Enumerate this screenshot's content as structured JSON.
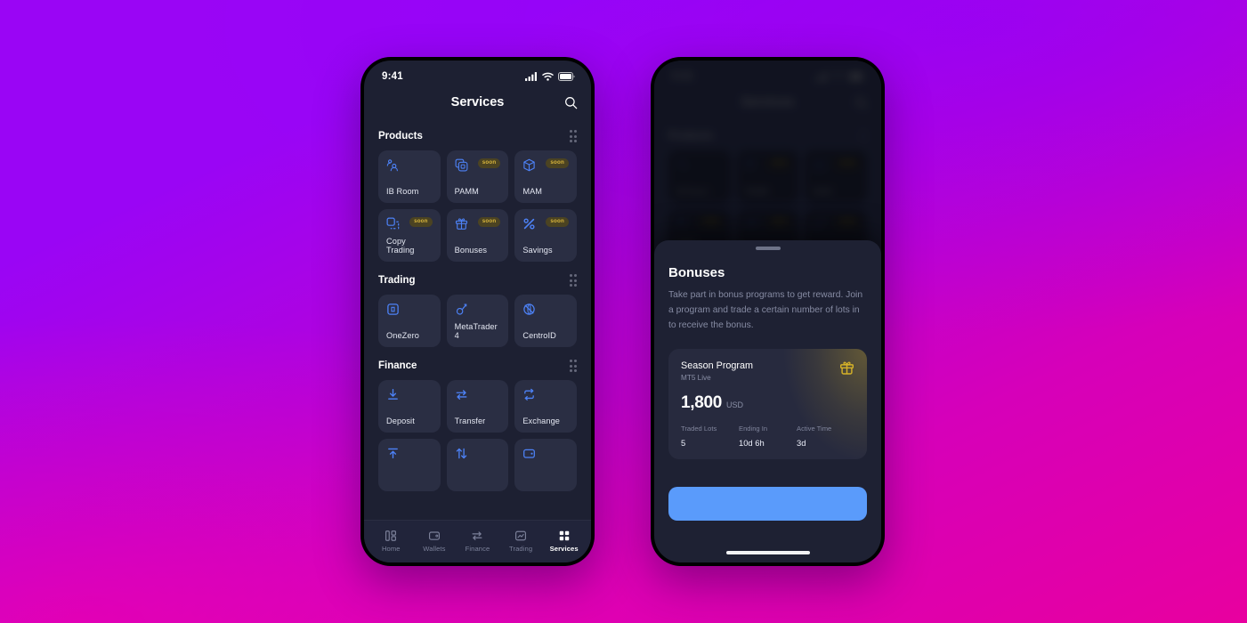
{
  "theme": {
    "bg_purple": "#9a05f5",
    "bg_magenta": "#e8009f",
    "screen_bg": "#1d2032",
    "tile_bg": "#2a2e43",
    "accent_blue": "#4d82f7",
    "cta_blue": "#5a9bfb",
    "badge_gold": "#d9b63c",
    "gift_gold": "#d6b228"
  },
  "phone_one": {
    "status_bar": {
      "time": "9:41",
      "signal_icon": "cellular-bars-icon",
      "wifi_icon": "wifi-icon",
      "battery_icon": "battery-icon"
    },
    "nav": {
      "title": "Services",
      "search_icon": "search-icon"
    },
    "sections": [
      {
        "title": "Products",
        "handle_icon": "drag-handle-icon",
        "tiles": [
          {
            "label": "IB Room",
            "icon": "users-icon",
            "badge": ""
          },
          {
            "label": "PAMM",
            "icon": "copy-box-icon",
            "badge": "soon"
          },
          {
            "label": "MAM",
            "icon": "cube-icon",
            "badge": "soon"
          },
          {
            "label": "Copy Trading",
            "icon": "copy-dashed-icon",
            "badge": "soon"
          },
          {
            "label": "Bonuses",
            "icon": "gift-icon",
            "badge": "soon"
          },
          {
            "label": "Savings",
            "icon": "percent-icon",
            "badge": "soon"
          }
        ]
      },
      {
        "title": "Trading",
        "handle_icon": "drag-handle-icon",
        "tiles": [
          {
            "label": "OneZero",
            "icon": "square-bracket-icon",
            "badge": ""
          },
          {
            "label": "MetaTrader 4",
            "icon": "mt4-icon",
            "badge": ""
          },
          {
            "label": "CentroID",
            "icon": "globe-slash-icon",
            "badge": ""
          }
        ]
      },
      {
        "title": "Finance",
        "handle_icon": "drag-handle-icon",
        "tiles": [
          {
            "label": "Deposit",
            "icon": "download-arrow-icon",
            "badge": ""
          },
          {
            "label": "Transfer",
            "icon": "exchange-arrows-icon",
            "badge": ""
          },
          {
            "label": "Exchange",
            "icon": "refresh-loop-icon",
            "badge": ""
          }
        ],
        "tiles_clipped": [
          {
            "label": "",
            "icon": "upload-arrow-icon",
            "badge": ""
          },
          {
            "label": "",
            "icon": "up-down-arrows-icon",
            "badge": ""
          },
          {
            "label": "",
            "icon": "wallet-icon",
            "badge": ""
          }
        ]
      }
    ],
    "tabbar": [
      {
        "label": "Home",
        "icon": "dashboard-icon",
        "active": false
      },
      {
        "label": "Wallets",
        "icon": "wallet-icon",
        "active": false
      },
      {
        "label": "Finance",
        "icon": "transfer-icon",
        "active": false
      },
      {
        "label": "Trading",
        "icon": "chart-icon",
        "active": false
      },
      {
        "label": "Services",
        "icon": "grid-icon",
        "active": true
      }
    ]
  },
  "phone_two": {
    "sheet": {
      "grabber_icon": "sheet-grabber-icon",
      "title": "Bonuses",
      "description": "Take part in bonus programs to get reward. Join\na program and trade a certain number of lots in\nto receive the bonus.",
      "card": {
        "name": "Season Program",
        "subtitle": "MT5 Live",
        "amount": "1,800",
        "currency": "USD",
        "gift_icon": "gift-icon",
        "stats": [
          {
            "key": "Traded Lots",
            "value": "5"
          },
          {
            "key": "Ending In",
            "value": "10d 6h"
          },
          {
            "key": "Active Time",
            "value": "3d"
          }
        ]
      },
      "cta_label": "",
      "home_indicator_icon": "home-indicator-icon"
    }
  }
}
